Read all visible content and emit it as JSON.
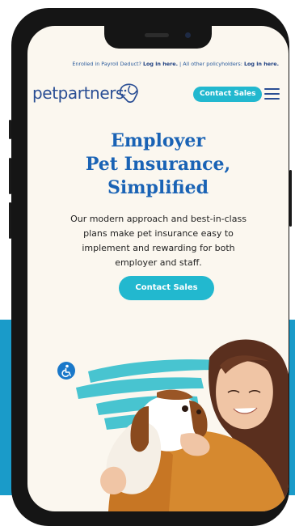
{
  "topbar": {
    "payroll_text": "Enrolled in Payroll Deduct?",
    "payroll_link": "Log in here.",
    "separator": "|",
    "other_text": "All other policyholders:",
    "other_link": "Log in here."
  },
  "header": {
    "logo_text": "petpartners",
    "contact_label": "Contact Sales"
  },
  "hero": {
    "title_line1": "Employer",
    "title_line2": "Pet Insurance,",
    "title_line3": "Simplified",
    "subtitle": "Our modern approach and best-in-class plans make pet insurance easy to implement and rewarding for both employer and staff.",
    "cta_label": "Contact Sales"
  },
  "colors": {
    "accent": "#22b8cf",
    "brand_blue": "#1a63b5",
    "band_blue": "#1a9bc9"
  },
  "icons": {
    "menu": "hamburger-menu-icon",
    "accessibility": "accessibility-icon",
    "logo_mark": "dog-logo-icon"
  }
}
